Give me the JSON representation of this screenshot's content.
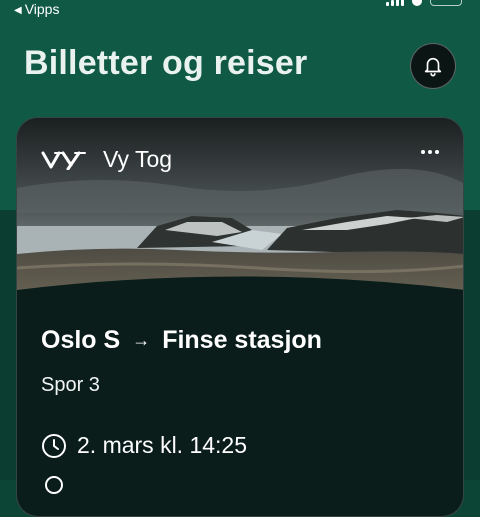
{
  "status_bar": {
    "back_app_label": "Vipps",
    "back_icon": "back-caret-icon",
    "icons": [
      "signal-icon",
      "wifi-icon",
      "battery-icon"
    ]
  },
  "header": {
    "title": "Billetter og reiser",
    "notifications_icon": "bell-icon"
  },
  "ticket": {
    "operator_logo_text": "VY",
    "operator_name": "Vy Tog",
    "more_icon": "more-dots-icon",
    "from": "Oslo S",
    "to": "Finse stasjon",
    "route_icon": "arrow-right-icon",
    "track": "Spor 3",
    "departure": "2. mars kl. 14:25",
    "departure_icon": "clock-icon"
  },
  "colors": {
    "header_bg": "#0f5945",
    "page_bg": "#0b3e31",
    "card_bg": "#0a1d1a",
    "text": "#ffffff"
  }
}
